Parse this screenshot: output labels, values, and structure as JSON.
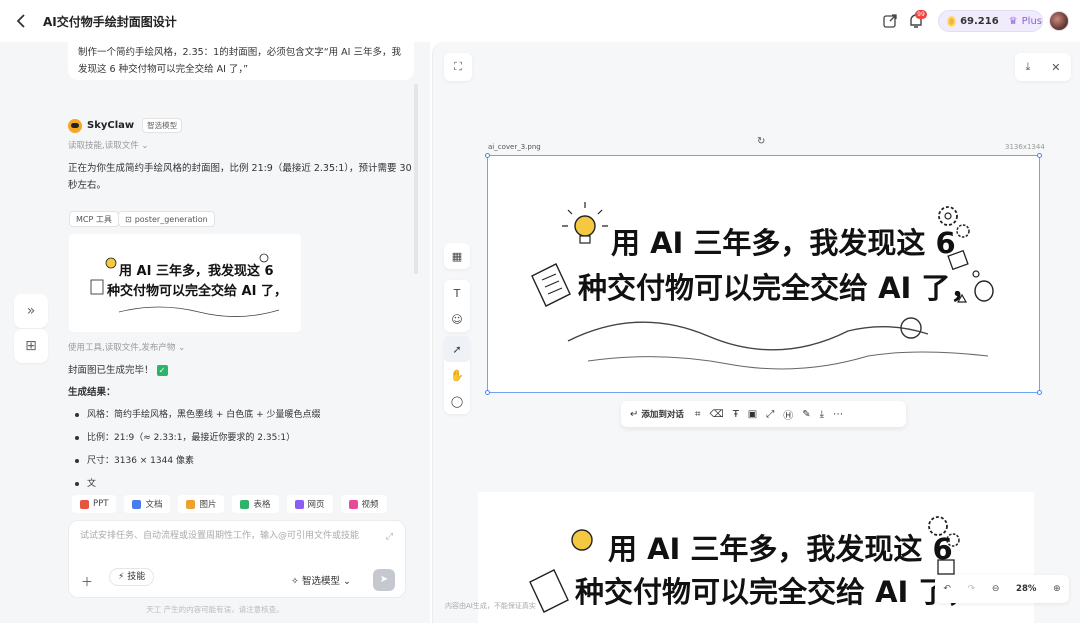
{
  "header": {
    "back_icon": "chevron-left-icon",
    "title": "AI交付物手绘封面图设计",
    "notification_count": "99",
    "credits": "69.216",
    "plan": "Plus"
  },
  "chat": {
    "user_message": "制作一个简约手绘风格，2.35：1的封面图，必须包含文字“用 AI 三年多，我发现这 6 种交付物可以完全交给 AI 了，”",
    "bot_name": "SkyClaw",
    "model_tag": "智选模型",
    "read_status": "读取技能,读取文件",
    "bot_reply": "正在为你生成简约手绘风格的封面图，比例 21:9（最接近 2.35:1），预计需要 30 秒左右。",
    "tool_tag_1": "MCP 工具",
    "tool_tag_2": "poster_generation",
    "thumb_line_1": "用 AI 三年多，我发现这 6",
    "thumb_line_2": "种交付物可以完全交给 AI 了，",
    "used_tools": "使用工具,读取文件,发布产物",
    "done_text": "封面图已生成完毕！",
    "result_heading": "生成结果：",
    "results": [
      {
        "label": "风格：",
        "value": "简约手绘风格，黑色墨线 + 白色底 + 少量暖色点缀"
      },
      {
        "label": "比例：",
        "value": "21:9（≈ 2.33:1，最接近你要求的 2.35:1）"
      },
      {
        "label": "尺寸：",
        "value": "3136 × 1344 像素"
      },
      {
        "label": "文",
        "value": ""
      }
    ],
    "chips": [
      {
        "label": "PPT",
        "color": "#e8533f"
      },
      {
        "label": "文档",
        "color": "#4a7cf0"
      },
      {
        "label": "图片",
        "color": "#f0a12c"
      },
      {
        "label": "表格",
        "color": "#2fb36b"
      },
      {
        "label": "网页",
        "color": "#8b5cf6"
      },
      {
        "label": "视频",
        "color": "#ec4899"
      }
    ],
    "composer_placeholder": "试试安排任务、自动流程或设置周期性工作，输入@可引用文件或技能",
    "skill_label": "技能",
    "model_select": "智选模型",
    "disclaimer": "天工 产生的内容可能有误，请注意核查。"
  },
  "preview": {
    "filename": "ai_cover_3.png",
    "dimensions": "3136x1344",
    "cover_line_1": "用 AI 三年多，我发现这 6",
    "cover_line_2": "种交付物可以完全交给 AI 了，",
    "action_label": "添加到对话",
    "ai_note": "内容由AI生成，不能保证真实",
    "zoom": "28%"
  }
}
